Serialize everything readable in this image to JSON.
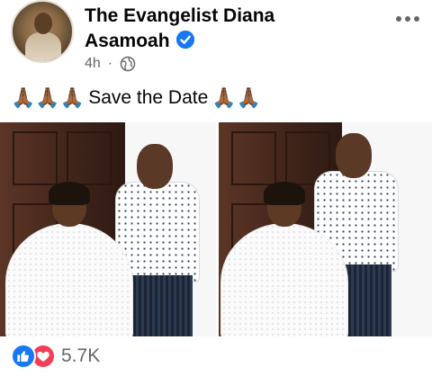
{
  "post": {
    "author": "The Evangelist Diana Asamoah",
    "timestamp": "4h",
    "separator": "·",
    "caption_prefix": "🙏🏾🙏🏾🙏🏾",
    "caption_text": "Save the Date",
    "caption_suffix": "🙏🏾🙏🏾",
    "reaction_count": "5.7K",
    "icons": {
      "verified": "verified-badge-icon",
      "privacy": "globe-icon",
      "menu": "more-icon",
      "reaction_like": "like-icon",
      "reaction_love": "love-icon"
    },
    "colors": {
      "verified_blue": "#1877f2",
      "like_blue": "#1877f2",
      "love_red": "#f33e58",
      "secondary_text": "#65676b"
    }
  }
}
